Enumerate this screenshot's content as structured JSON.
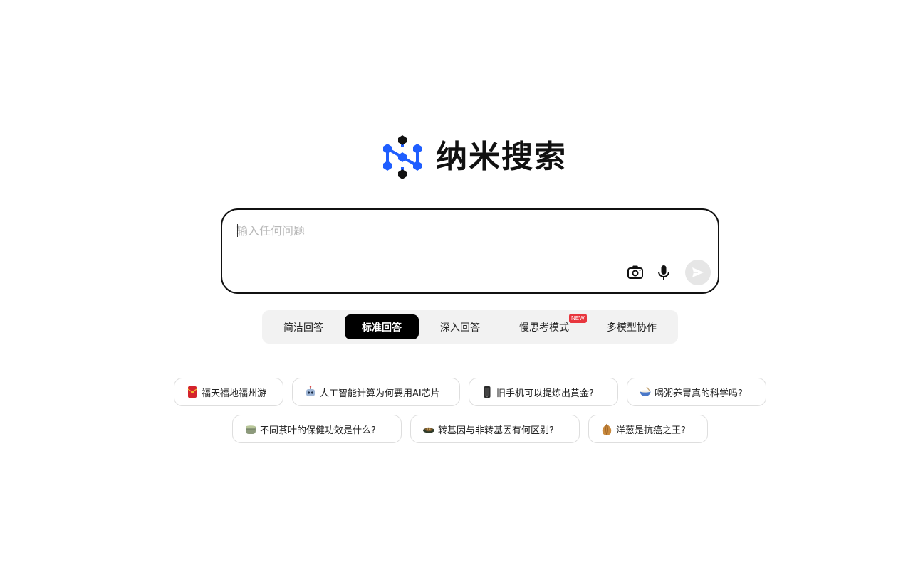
{
  "logo": {
    "text": "纳米搜索"
  },
  "search": {
    "placeholder": "输入任何问题",
    "value": ""
  },
  "toolbar": {
    "camera_icon": "camera-icon",
    "mic_icon": "microphone-icon",
    "send_icon": "send-icon"
  },
  "modes": {
    "tabs": [
      {
        "label": "简洁回答",
        "active": false
      },
      {
        "label": "标准回答",
        "active": true
      },
      {
        "label": "深入回答",
        "active": false
      },
      {
        "label": "慢思考模式",
        "active": false,
        "badge": "NEW"
      },
      {
        "label": "多模型协作",
        "active": false
      }
    ]
  },
  "suggestions": [
    {
      "icon": "red-envelope-icon",
      "text": "福天福地福州游"
    },
    {
      "icon": "robot-icon",
      "text": "人工智能计算为何要用AI芯片"
    },
    {
      "icon": "phone-icon",
      "text": "旧手机可以提炼出黄金?"
    },
    {
      "icon": "bowl-icon",
      "text": "喝粥养胃真的科学吗?"
    },
    {
      "icon": "tea-icon",
      "text": "不同茶叶的保健功效是什么?"
    },
    {
      "icon": "dish-icon",
      "text": "转基因与非转基因有何区别?"
    },
    {
      "icon": "onion-icon",
      "text": "洋葱是抗癌之王?"
    }
  ],
  "colors": {
    "accent": "#1f5eff",
    "badge": "#e8363e",
    "active_tab": "#000000"
  }
}
